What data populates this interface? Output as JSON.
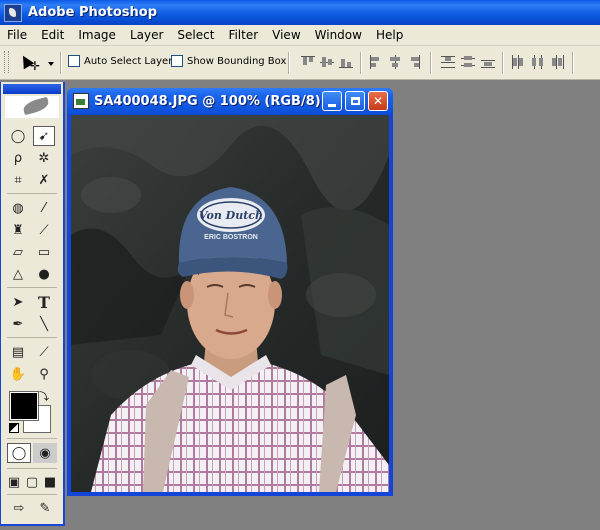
{
  "app": {
    "title": "Adobe Photoshop"
  },
  "menu": [
    "File",
    "Edit",
    "Image",
    "Layer",
    "Select",
    "Filter",
    "View",
    "Window",
    "Help"
  ],
  "options": {
    "auto_select_layer": {
      "label": "Auto Select Layer",
      "checked": false
    },
    "show_bounding_box": {
      "label": "Show Bounding Box",
      "checked": false
    }
  },
  "document": {
    "title": "SA400048.JPG @ 100% (RGB/8)",
    "cap_text_1": "Von Dutch",
    "cap_text_2": "ERIC BOSTRON"
  },
  "toolbox": {
    "tools": [
      "marquee-tool",
      "move-tool",
      "lasso-tool",
      "magic-wand-tool",
      "crop-tool",
      "slice-tool",
      "healing-brush-tool",
      "brush-tool",
      "clone-stamp-tool",
      "history-brush-tool",
      "eraser-tool",
      "gradient-tool",
      "blur-tool",
      "dodge-tool",
      "path-selection-tool",
      "type-tool",
      "pen-tool",
      "line-tool",
      "notes-tool",
      "eyedropper-tool",
      "hand-tool",
      "zoom-tool"
    ],
    "active_tool": "move-tool",
    "foreground_color": "#000000",
    "background_color": "#ffffff"
  }
}
